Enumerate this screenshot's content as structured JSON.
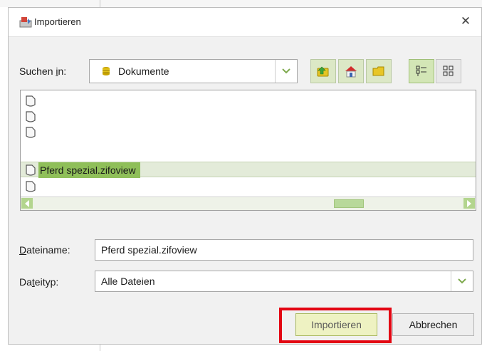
{
  "dialog": {
    "title": "Importieren",
    "close_glyph": "✕"
  },
  "lookin": {
    "label_prefix": "Suchen ",
    "label_accel": "i",
    "label_suffix": "n:",
    "value": "Dokumente"
  },
  "toolbar": {
    "buttons": [
      "up-folder-icon",
      "home-icon",
      "new-folder-icon",
      "list-view-icon",
      "details-view-icon"
    ]
  },
  "files": {
    "rows": [
      {
        "name": "",
        "selected": false
      },
      {
        "name": "",
        "selected": false
      },
      {
        "name": "",
        "selected": false
      },
      {
        "name": "Pferd spezial.zifoview",
        "selected": true
      },
      {
        "name": "",
        "selected": false
      }
    ]
  },
  "filename": {
    "label_accel": "D",
    "label_rest": "ateiname:",
    "value": "Pferd spezial.zifoview"
  },
  "filetype": {
    "label_prefix": "Da",
    "label_accel": "t",
    "label_rest": "eityp:",
    "value": "Alle Dateien"
  },
  "actions": {
    "import_label": "Importieren",
    "cancel_label": "Abbrechen"
  },
  "colors": {
    "accent_green": "#8fbf59",
    "highlight_red": "#e30613"
  }
}
